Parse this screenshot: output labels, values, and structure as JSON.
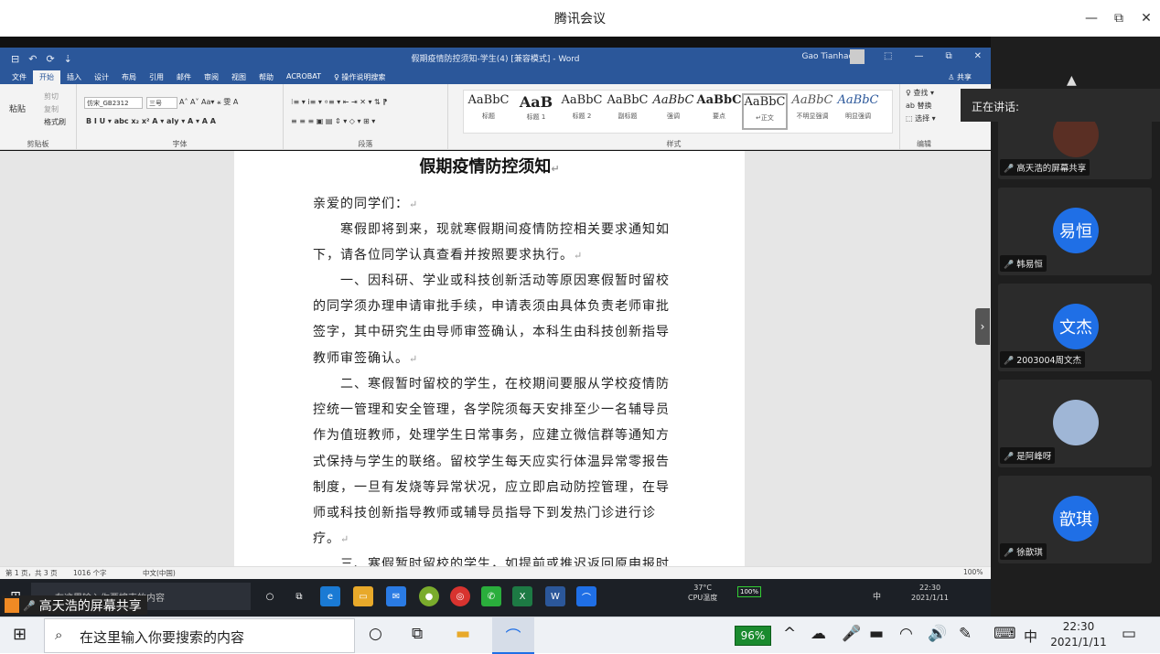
{
  "app": {
    "title": "腾讯会议",
    "minimize": "—",
    "maximize": "⧉",
    "close": "✕"
  },
  "word": {
    "doc_title": "假期疫情防控须知-学生(4) [兼容模式] - Word",
    "user": "Gao Tianhao",
    "quick_access": [
      "⊟",
      "↶",
      "⟳",
      "⇣"
    ],
    "window_buttons": [
      "⬚",
      "—",
      "⧉",
      "✕"
    ],
    "tabs": [
      "文件",
      "开始",
      "插入",
      "设计",
      "布局",
      "引用",
      "邮件",
      "审阅",
      "视图",
      "帮助",
      "ACROBAT",
      "♀ 操作说明搜索"
    ],
    "share": "♙ 共享",
    "ribbon": {
      "clipboard": {
        "label": "剪贴板",
        "paste": "粘贴",
        "cut": "剪切",
        "copy": "复制",
        "format_painter": "格式刷"
      },
      "font": {
        "label": "字体",
        "name": "仿宋_GB2312",
        "size": "三号",
        "row1": "A˄ A˅ Aa▾ ⚹ 雯 A",
        "row2": "B I U ▾ abc x₂ x² A ▾ aly ▾ A ▾ A A"
      },
      "paragraph": {
        "label": "段落",
        "row1": "⁝≡ ▾ ⅰ≡ ▾ ⸰≡ ▾ ⇤ ⇥ ✕ ▾ ⇅ ⁋",
        "row2": "≡ ≡ ≡ ▣ ▤ ⇕ ▾ ◇ ▾ ⊞ ▾"
      },
      "styles": {
        "label": "样式",
        "items": [
          {
            "preview": "AaBbC",
            "name": "标题"
          },
          {
            "preview": "AaB",
            "name": "标题 1"
          },
          {
            "preview": "AaBbC",
            "name": "标题 2"
          },
          {
            "preview": "AaBbC",
            "name": "副标题"
          },
          {
            "preview": "AaBbC",
            "name": "强调"
          },
          {
            "preview": "AaBbC",
            "name": "要点"
          },
          {
            "preview": "AaBbC",
            "name": "↵正文"
          },
          {
            "preview": "AaBbC",
            "name": "不明显强调"
          },
          {
            "preview": "AaBbC",
            "name": "明显强调"
          }
        ]
      },
      "editing": {
        "label": "编辑",
        "find": "♀ 查找 ▾",
        "replace": "ab 替换",
        "select": "⬚ 选择 ▾"
      }
    },
    "document": {
      "title": "假期疫情防控须知",
      "salutation": "亲爱的同学们：",
      "p1": "寒假即将到来，现就寒假期间疫情防控相关要求通知如下，请各位同学认真查看并按照要求执行。",
      "p2": "一、因科研、学业或科技创新活动等原因寒假暂时留校的同学须办理申请审批手续，申请表须由具体负责老师审批签字，其中研究生由导师审签确认，本科生由科技创新指导教师审签确认。",
      "p3": "二、寒假暂时留校的学生，在校期间要服从学校疫情防控统一管理和安全管理，各学院须每天安排至少一名辅导员作为值班教师，处理学生日常事务，应建立微信群等通知方式保持与学生的联络。留校学生每天应实行体温异常零报告制度，一旦有发烧等异常状况，应立即启动防控管理，在导师或科技创新指导教师或辅导员指导下到发热门诊进行诊疗。",
      "p4": "三、寒假暂时留校的学生，如提前或推迟返回原申报时间"
    },
    "status": {
      "page": "第 1 页，共 3 页",
      "words": "1016 个字",
      "lang": "中文(中国)",
      "zoom": "100%"
    }
  },
  "inner_taskbar": {
    "search_placeholder": "在这里输入你要搜索的内容",
    "temp": "37°C",
    "cpu": "CPU温度",
    "battery": "100%",
    "time": "22:30",
    "date": "2021/1/11",
    "ime": "中"
  },
  "panel": {
    "speaking_label": "正在讲话:",
    "participants": [
      {
        "initials": "",
        "name": "高天浩的屏幕共享"
      },
      {
        "initials": "易恒",
        "name": "韩易恒"
      },
      {
        "initials": "文杰",
        "name": "2003004周文杰"
      },
      {
        "initials": "",
        "name": "是阿峰呀"
      },
      {
        "initials": "歆琪",
        "name": "徐歆琪"
      }
    ],
    "arrow_up": "▲",
    "arrow_down": "▼",
    "collapse": "›"
  },
  "screen_share_label": "高天浩的屏幕共享",
  "taskbar": {
    "search_placeholder": "在这里输入你要搜索的内容",
    "battery": "96%",
    "ime": "中",
    "time": "22:30",
    "date": "2021/1/11"
  },
  "colors": {
    "word_blue": "#2b579a",
    "meeting_blue": "#1f6fe6",
    "battery_green": "#1a8a2e"
  }
}
